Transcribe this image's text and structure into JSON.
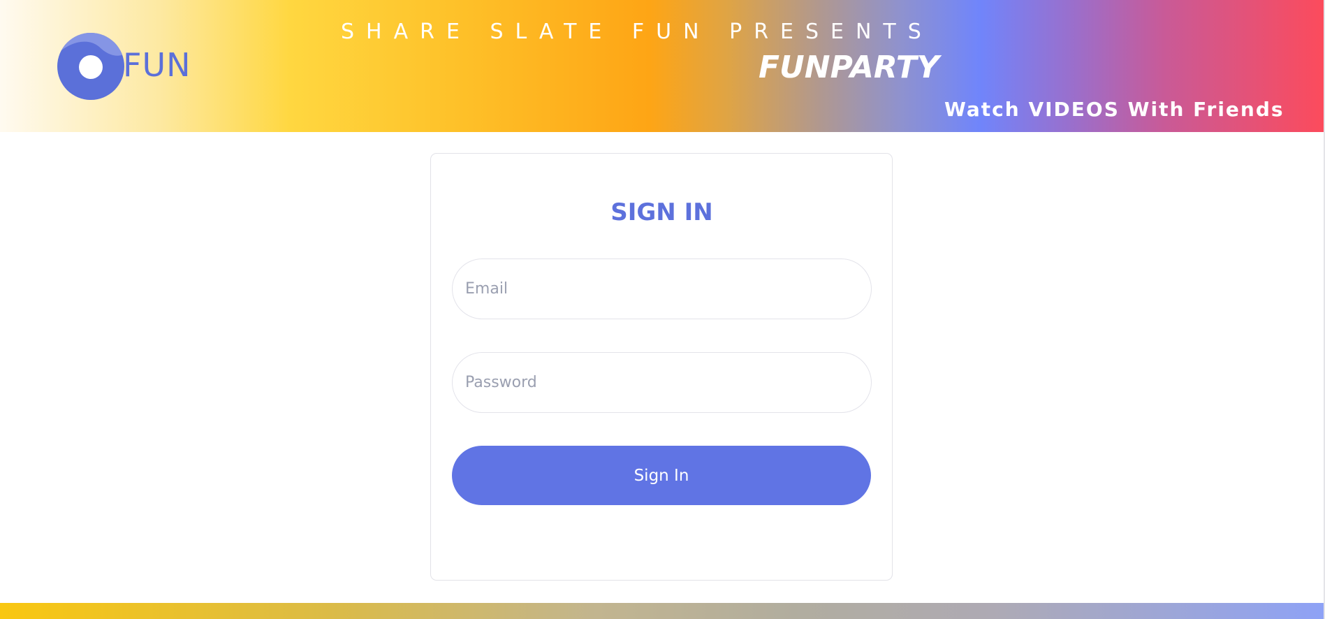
{
  "header": {
    "logo_text": "FUN",
    "presents_text": "SHARE SLATE FUN PRESENTS",
    "brand_title": "FUNPARTY",
    "tagline": "Watch VIDEOS With Friends"
  },
  "signin": {
    "title": "SIGN IN",
    "email": {
      "placeholder": "Email",
      "value": ""
    },
    "password": {
      "placeholder": "Password",
      "value": ""
    },
    "submit_label": "Sign In"
  },
  "colors": {
    "accent": "#6074e4",
    "title": "#5d71dc",
    "logo": "#5b70d9"
  },
  "icons": {
    "logo_mark": "fun-logo-icon"
  }
}
